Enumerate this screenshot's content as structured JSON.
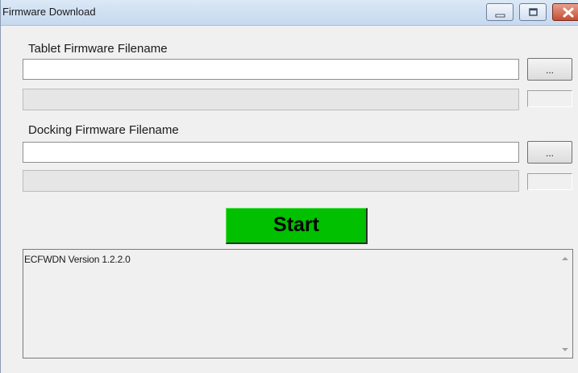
{
  "window": {
    "title": "Firmware Download"
  },
  "tablet": {
    "label": "Tablet Firmware Filename",
    "filename_value": "",
    "browse_label": "...",
    "progress": 0
  },
  "docking": {
    "label": "Docking Firmware Filename",
    "filename_value": "",
    "browse_label": "...",
    "progress": 0
  },
  "actions": {
    "start_label": "Start"
  },
  "log": {
    "text": "ECFWDN Version 1.2.2.0"
  },
  "icons": {
    "minimize": "minimize-icon",
    "maximize": "maximize-icon",
    "close": "close-icon",
    "scroll_up": "scroll-up-arrow-icon",
    "scroll_down": "scroll-down-arrow-icon"
  },
  "colors": {
    "start_button": "#00c000",
    "close_button": "#c44e33"
  }
}
